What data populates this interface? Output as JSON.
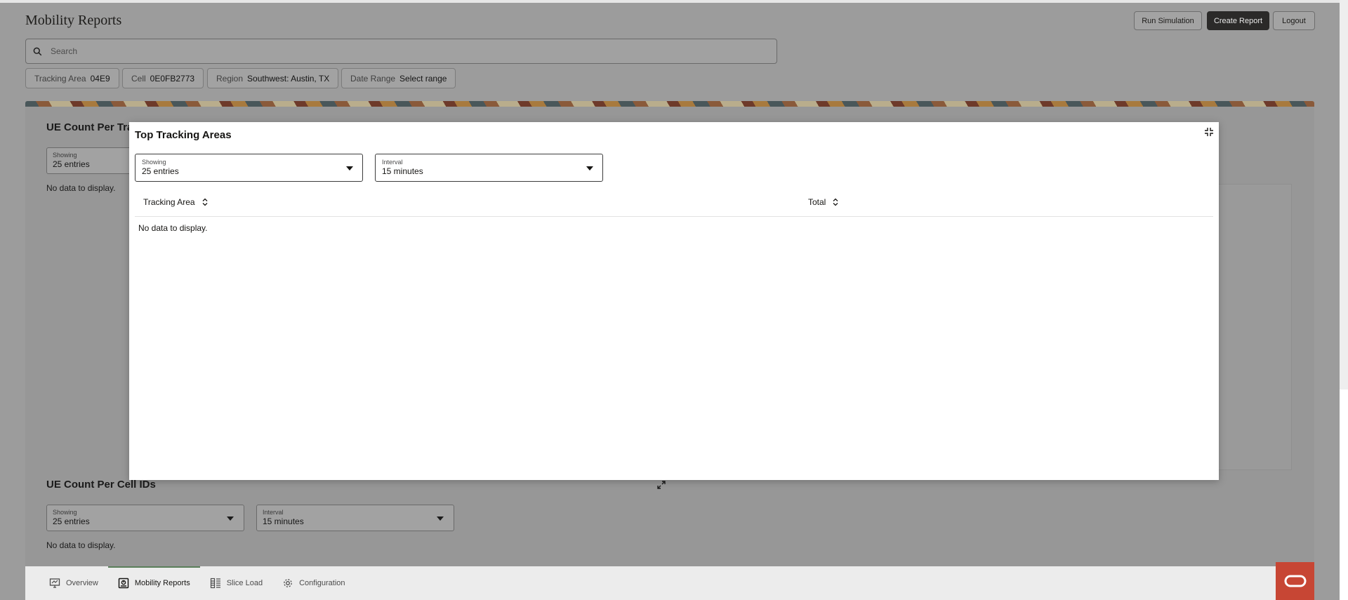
{
  "header": {
    "title": "Mobility Reports",
    "buttons": {
      "run_simulation": "Run Simulation",
      "create_report": "Create Report",
      "logout": "Logout"
    }
  },
  "search": {
    "placeholder": "Search"
  },
  "filters": [
    {
      "label": "Tracking Area",
      "value": "04E9"
    },
    {
      "label": "Cell",
      "value": "0E0FB2773"
    },
    {
      "label": "Region",
      "value": "Southwest: Austin, TX"
    },
    {
      "label": "Date Range",
      "value": "Select range"
    }
  ],
  "background_panels": {
    "tracking_card": {
      "title": "UE Count Per Tra",
      "showing": {
        "label": "Showing",
        "value": "25 entries"
      },
      "no_data": "No data to display."
    },
    "cell_card": {
      "title": "UE Count Per Cell IDs",
      "showing": {
        "label": "Showing",
        "value": "25 entries"
      },
      "interval": {
        "label": "Interval",
        "value": "15 minutes"
      },
      "no_data": "No data to display."
    }
  },
  "modal": {
    "title": "Top Tracking Areas",
    "showing": {
      "label": "Showing",
      "value": "25 entries"
    },
    "interval": {
      "label": "Interval",
      "value": "15 minutes"
    },
    "columns": [
      "Tracking Area",
      "Total"
    ],
    "rows": [],
    "no_data": "No data to display."
  },
  "footer_nav": [
    {
      "label": "Overview",
      "icon": "monitor-icon",
      "active": false
    },
    {
      "label": "Mobility Reports",
      "icon": "report-icon",
      "active": true
    },
    {
      "label": "Slice Load",
      "icon": "grid-icon",
      "active": false
    },
    {
      "label": "Configuration",
      "icon": "gear-icon",
      "active": false
    }
  ],
  "colors": {
    "overlay_bg": "#9c9c9c",
    "primary_button": "#2b2a29",
    "oracle_red": "#c74634",
    "active_tab_accent": "#5b7f5a"
  }
}
